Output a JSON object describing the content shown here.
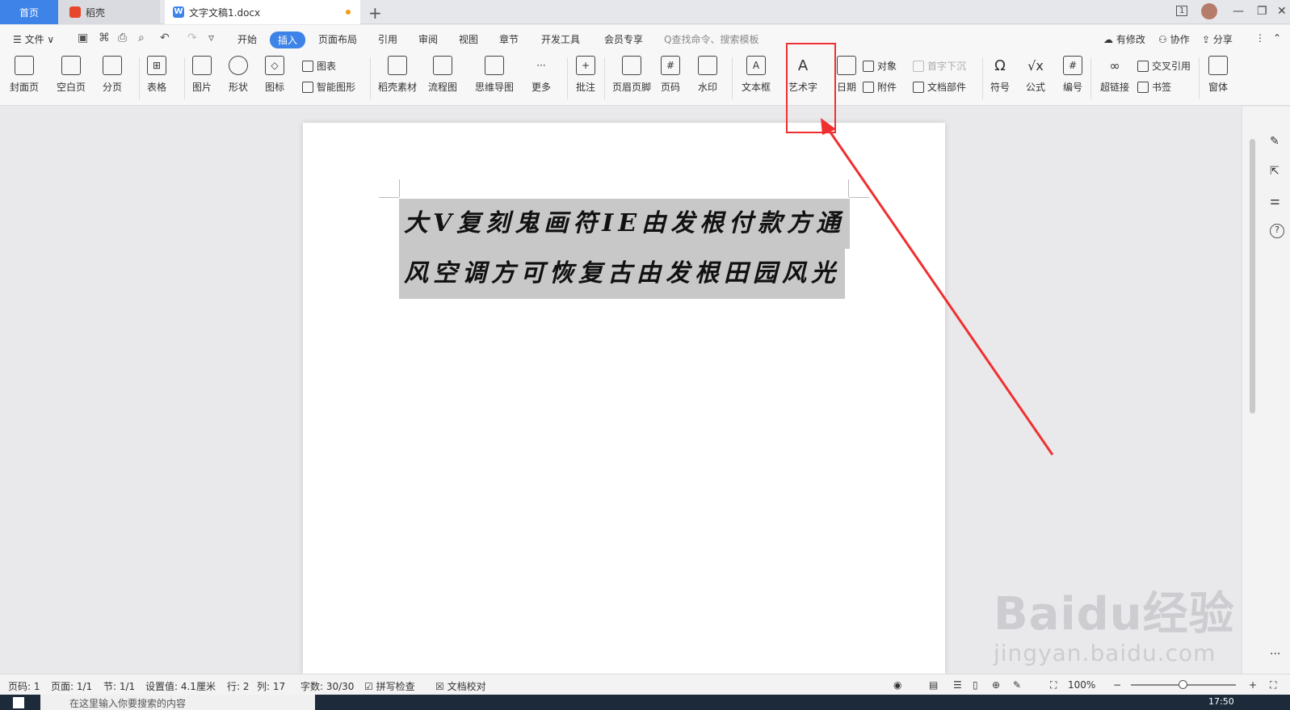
{
  "tabs": {
    "home": "首页",
    "daoke": "稻壳",
    "doc": "文字文稿1.docx",
    "add": "+"
  },
  "window": {
    "page_indicator": "1",
    "minimize": "—",
    "restore": "❐",
    "close": "✕"
  },
  "menu": {
    "file": "☰ 文件 ∨",
    "items": [
      "开始",
      "插入",
      "页面布局",
      "引用",
      "审阅",
      "视图",
      "章节",
      "开发工具",
      "会员专享"
    ],
    "search_placeholder": "Q查找命令、搜索模板",
    "right": [
      "有修改",
      "协作",
      "分享"
    ]
  },
  "ribbon": {
    "big": [
      "封面页",
      "空白页",
      "分页",
      "表格",
      "图片",
      "形状",
      "图标",
      "稻壳素材",
      "流程图",
      "思维导图",
      "更多",
      "批注",
      "页眉页脚",
      "页码",
      "水印",
      "文本框",
      "艺术字",
      "日期",
      "符号",
      "公式",
      "编号",
      "超链接",
      "窗体"
    ],
    "small": {
      "chart": "图表",
      "smart_shape": "智能图形",
      "object": "对象",
      "attachment": "附件",
      "drop_cap": "首字下沉",
      "doc_parts": "文档部件",
      "cross_ref": "交叉引用",
      "bookmark": "书签"
    }
  },
  "document": {
    "line1": "大V复刻鬼画符IE由发根付款方通",
    "line2": "风空调方可恢复古由发根田园风光"
  },
  "watermark": {
    "main": "Baidu经验",
    "sub": "jingyan.baidu.com"
  },
  "status": {
    "page_no": "页码: 1",
    "pages": "页面: 1/1",
    "section": "节: 1/1",
    "setting": "设置值: 4.1厘米",
    "row": "行: 2",
    "col": "列: 17",
    "words": "字数: 30/30",
    "spell": "拼写检查",
    "proof": "文档校对",
    "zoom": "100%"
  },
  "taskbar": {
    "search": "在这里输入你要搜索的内容",
    "time": "17:50"
  },
  "colors": {
    "accent": "#3d83e8",
    "highlight": "#f03030"
  }
}
